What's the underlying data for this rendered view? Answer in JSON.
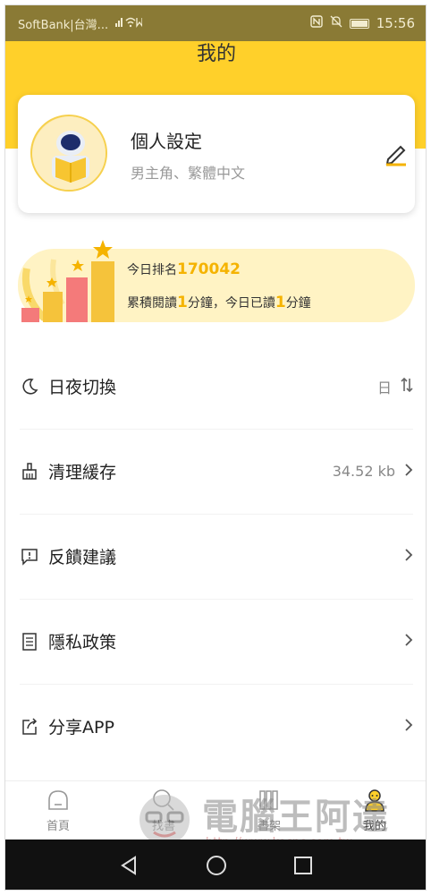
{
  "status_bar": {
    "carrier": "SoftBank|台灣...",
    "time": "15:56"
  },
  "header": {
    "title": "我的"
  },
  "profile": {
    "name": "個人設定",
    "subtitle": "男主角、繁體中文"
  },
  "rank": {
    "prefix": "今日排名",
    "number": "170042",
    "read_prefix": "累積閱讀",
    "total_minutes": "1",
    "mid": "分鐘，今日已讀",
    "today_minutes": "1",
    "suffix": "分鐘"
  },
  "menu": [
    {
      "label": "日夜切換",
      "icon": "moon-icon",
      "value": "日"
    },
    {
      "label": "清理緩存",
      "icon": "broom-icon",
      "value": "34.52 kb"
    },
    {
      "label": "反饋建議",
      "icon": "feedback-icon",
      "value": ""
    },
    {
      "label": "隱私政策",
      "icon": "document-icon",
      "value": ""
    },
    {
      "label": "分享APP",
      "icon": "share-icon",
      "value": ""
    }
  ],
  "tabs": [
    {
      "label": "首頁",
      "icon": "home-icon"
    },
    {
      "label": "找書",
      "icon": "search-icon"
    },
    {
      "label": "書架",
      "icon": "bookshelf-icon"
    },
    {
      "label": "我的",
      "icon": "profile-icon"
    }
  ],
  "watermark": {
    "text": "電腦王阿達",
    "url": "http://www.kocpc.com.tw"
  },
  "colors": {
    "accent": "#ffd02a",
    "highlight": "#f5b300",
    "rank_bg": "#fff3c4"
  }
}
